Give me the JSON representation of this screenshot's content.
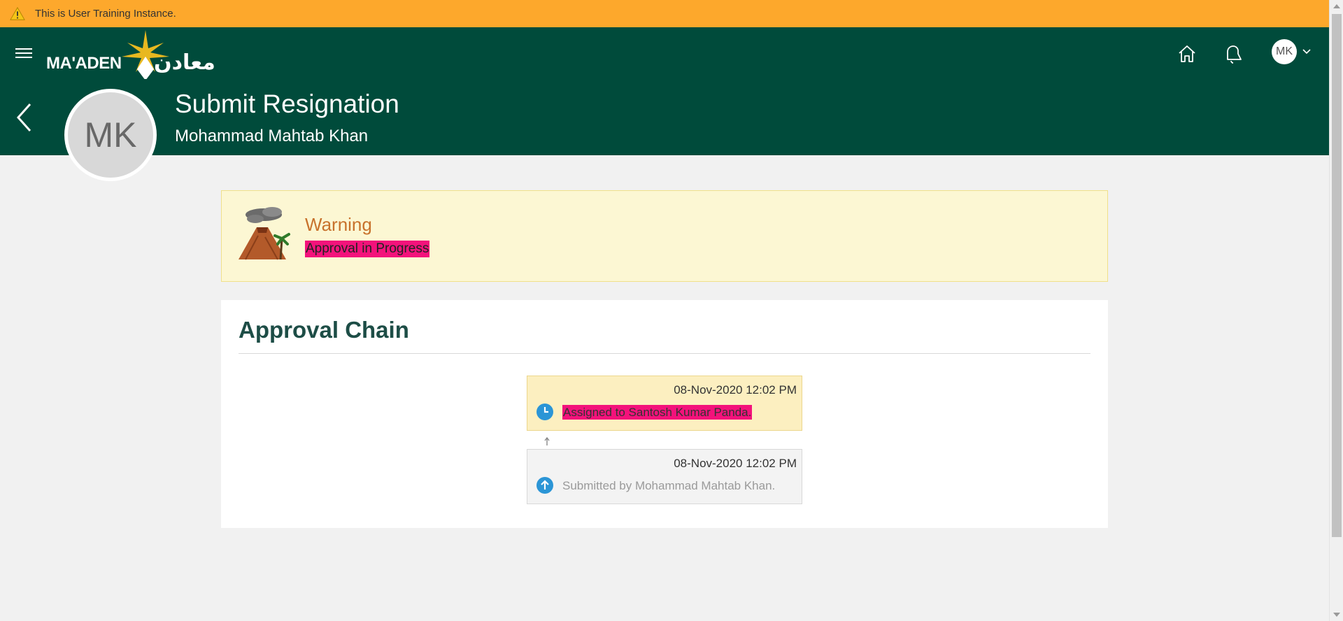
{
  "banner": {
    "text": "This is User Training Instance."
  },
  "brand": {
    "logo_en": "MA'ADEN",
    "logo_ar": "معادن"
  },
  "header": {
    "avatar_initials": "MK",
    "title": "Submit Resignation",
    "subtitle": "Mohammad Mahtab Khan",
    "profile_initials": "MK"
  },
  "warning": {
    "title": "Warning",
    "message": "Approval in Progress"
  },
  "approval_chain": {
    "title": "Approval Chain",
    "steps": [
      {
        "date": "08-Nov-2020 12:02 PM",
        "text": "Assigned to Santosh Kumar Panda.",
        "status_icon": "clock-icon"
      },
      {
        "date": "08-Nov-2020 12:02 PM",
        "text": "Submitted by Mohammad Mahtab Khan.",
        "status_icon": "arrow-up-icon"
      }
    ]
  },
  "colors": {
    "header_bg": "#004b3b",
    "banner_bg": "#fda82c",
    "warning_bg": "#fcf7d3",
    "warning_title": "#c8722c",
    "highlight": "#f3127b",
    "icon_blue": "#2b95d6"
  }
}
